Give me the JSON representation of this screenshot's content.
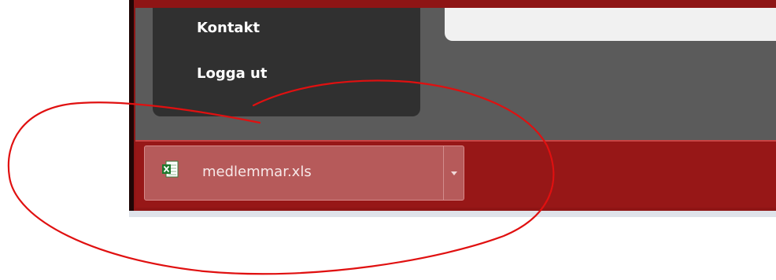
{
  "nav": {
    "items": [
      {
        "label": "Kontakt"
      },
      {
        "label": "Logga ut"
      }
    ]
  },
  "download_bar": {
    "file_name": "medlemmar.xls",
    "file_icon": "excel-file-icon",
    "menu_icon": "chevron-down-icon"
  },
  "colors": {
    "frame": "#8e1515",
    "download_bar": "#971717",
    "download_item": "#b65a5a",
    "nav_panel": "#303030",
    "page_background": "#5b5b5b",
    "annotation": "#e01010"
  }
}
